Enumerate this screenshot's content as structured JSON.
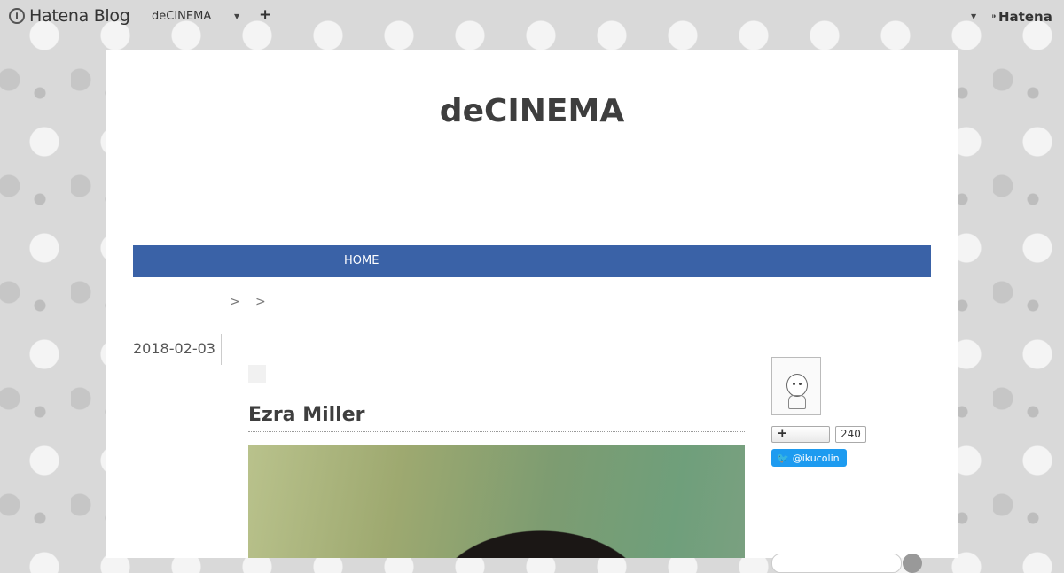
{
  "topbar": {
    "brand": "Hatena Blog",
    "blog_name": "deCINEMA",
    "add_label": "+",
    "account": "Hatena"
  },
  "blog": {
    "title": "deCINEMA"
  },
  "nav": {
    "items": [
      {
        "label": "HOME"
      }
    ]
  },
  "breadcrumb": {
    "separators": [
      ">",
      ">"
    ]
  },
  "entry": {
    "date": "2018-02-03",
    "title": "Ezra Miller"
  },
  "sidebar": {
    "bookmark_count": "240",
    "twitter_handle": "@ikucolin"
  },
  "colors": {
    "nav_bg": "#3a62a7",
    "twitter": "#1d9bf0"
  },
  "icons": [
    "hatena-blog-logo-icon",
    "chevron-down-icon",
    "plus-icon",
    "hatena-logo-icon",
    "hatena-bookmark-icon",
    "twitter-bird-icon"
  ]
}
